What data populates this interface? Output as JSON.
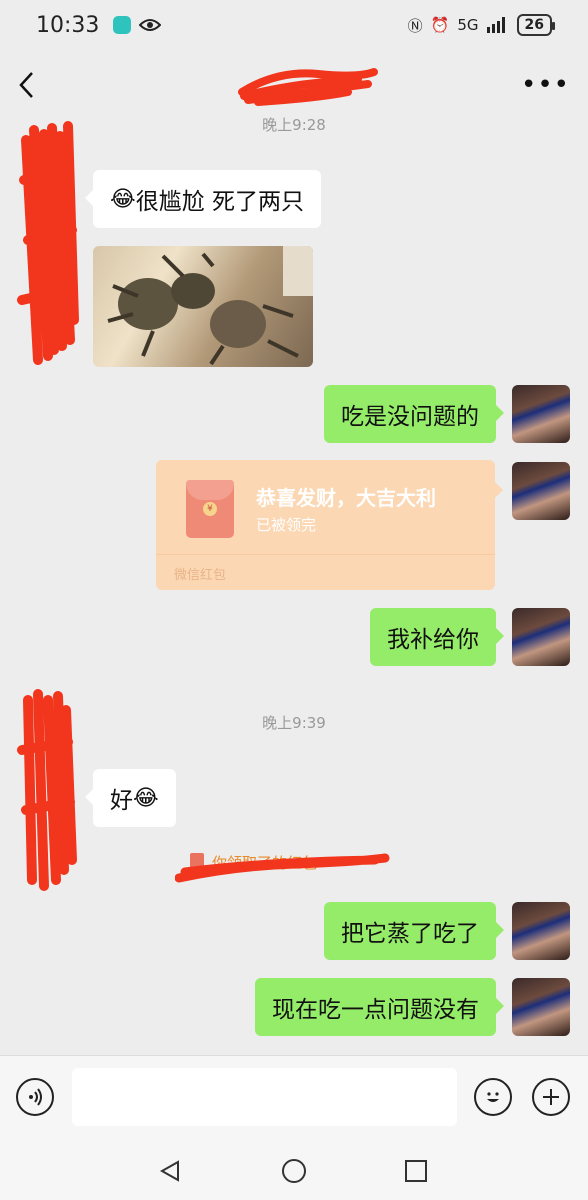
{
  "status_bar": {
    "time": "10:33",
    "network": "5G",
    "battery": "26"
  },
  "header": {
    "title": "",
    "back_icon": "chevron-left-icon",
    "more_icon": "more-dots-icon"
  },
  "messages": {
    "timestamp1": "晚上9:28",
    "msg1_emoji": "😂",
    "msg1_text": "很尴尬 死了两只",
    "msg2_text": "吃是没问题的",
    "red_packet": {
      "title": "恭喜发财，大吉大利",
      "status": "已被领完",
      "footer": "微信红包"
    },
    "msg3_text": "我补给你",
    "timestamp2": "晚上9:39",
    "msg4_text": "好",
    "msg4_emoji": "😂",
    "system_notice": "你领取了的红包",
    "msg5_text": "把它蒸了吃了",
    "msg6_text": "现在吃一点问题没有"
  },
  "input_bar": {
    "voice_icon": "voice-icon",
    "placeholder": "",
    "emoji_icon": "emoji-icon",
    "plus_icon": "plus-icon"
  },
  "nav": {
    "back": "nav-back-icon",
    "home": "nav-home-icon",
    "recent": "nav-recent-icon"
  },
  "colors": {
    "background": "#ededed",
    "bubble_right": "#95ec69",
    "bubble_left": "#ffffff",
    "red_packet": "#fbd7b3",
    "redaction": "#f2361d"
  }
}
